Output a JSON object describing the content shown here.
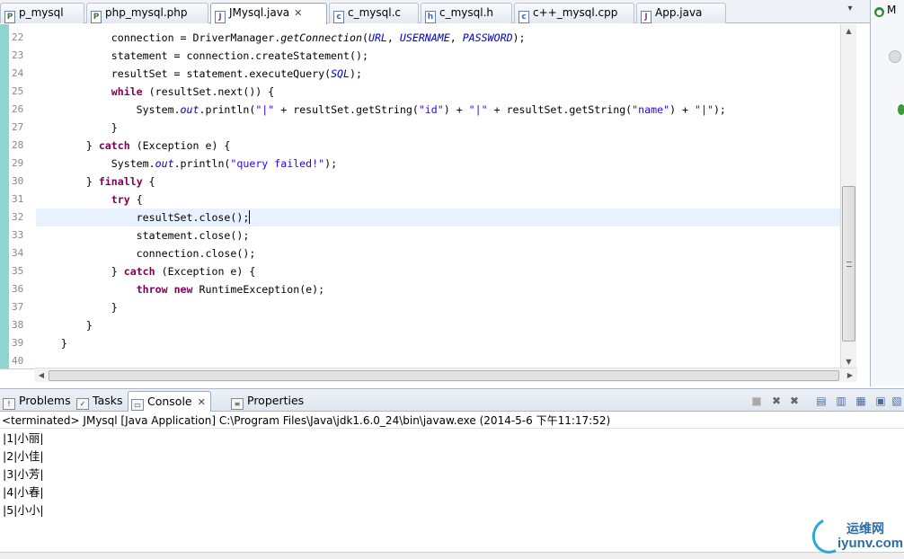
{
  "editor_tabs": [
    {
      "label": "p_mysql",
      "icon": "php-file-icon",
      "active": false
    },
    {
      "label": "php_mysql.php",
      "icon": "php-file-icon",
      "active": false
    },
    {
      "label": "JMysql.java",
      "icon": "java-file-icon",
      "active": true,
      "close": "✕"
    },
    {
      "label": "c_mysql.c",
      "icon": "c-file-icon",
      "active": false
    },
    {
      "label": "c_mysql.h",
      "icon": "c-file-icon",
      "active": false
    },
    {
      "label": "c++_mysql.cpp",
      "icon": "cpp-file-icon",
      "active": false
    },
    {
      "label": "App.java",
      "icon": "java-file-icon",
      "active": false
    }
  ],
  "tab_overflow": "▾",
  "right_pane": {
    "title": "M"
  },
  "line_numbers": [
    "22",
    "23",
    "24",
    "25",
    "26",
    "27",
    "28",
    "29",
    "30",
    "31",
    "32",
    "33",
    "34",
    "35",
    "36",
    "37",
    "38",
    "39",
    "40"
  ],
  "current_line_index": 10,
  "console_tabs": [
    {
      "label": "Problems",
      "icon": "problems-icon",
      "active": false
    },
    {
      "label": "Tasks",
      "icon": "tasks-icon",
      "active": false
    },
    {
      "label": "Console",
      "icon": "console-icon",
      "active": true,
      "close": "✕"
    },
    {
      "label": "Properties",
      "icon": "properties-icon",
      "active": false
    }
  ],
  "console_header": "<terminated> JMysql [Java Application] C:\\Program Files\\Java\\jdk1.6.0_24\\bin\\javaw.exe (2014-5-6 下午11:17:52)",
  "console_output": [
    "|1|小丽|",
    "|2|小佳|",
    "|3|小芳|",
    "|4|小春|",
    "|5|小小|"
  ],
  "watermark": {
    "cn": "运维网",
    "en": "iyunv.com"
  },
  "colors": {
    "keyword": "#7f0055",
    "string": "#2a00ff",
    "field": "#0000c0",
    "current_line": "#e8f2fe",
    "gutter": "#8fd5cf"
  }
}
